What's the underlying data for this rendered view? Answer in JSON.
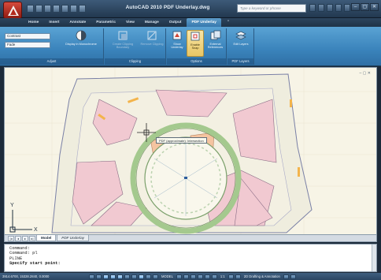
{
  "window": {
    "title": "AutoCAD 2010   PDF Underlay.dwg",
    "search_placeholder": "Type a keyword or phrase",
    "controls": [
      "–",
      "▢",
      "✕"
    ]
  },
  "ribbon": {
    "tabs": [
      {
        "label": "Home",
        "active": false
      },
      {
        "label": "Insert",
        "active": false
      },
      {
        "label": "Annotate",
        "active": false
      },
      {
        "label": "Parametric",
        "active": false
      },
      {
        "label": "View",
        "active": false
      },
      {
        "label": "Manage",
        "active": false
      },
      {
        "label": "Output",
        "active": false
      },
      {
        "label": "PDF Underlay",
        "active": true
      },
      {
        "label": "⌃",
        "active": false
      }
    ],
    "adjust": {
      "title": "Adjust",
      "contrast_label": "Contrast",
      "fade_label": "Fade",
      "monochrome_label": "Display in Monochrome"
    },
    "clipping": {
      "title": "Clipping",
      "create_clip_label": "Create Clipping Boundary",
      "remove_clip_label": "Remove Clipping"
    },
    "options": {
      "title": "Options",
      "show_underlay_label": "Show Underlay",
      "enable_snap_label": "Enable Snap",
      "external_refs_label": "External References"
    },
    "pdf_layers": {
      "title": "PDF Layers",
      "edit_layers_label": "Edit Layers"
    }
  },
  "drawing": {
    "snap_tooltip": "PDF (approximate): Intersection",
    "ucs_x_label": "X",
    "ucs_y_label": "Y",
    "viewport_ctrls": "– ▢ ✕"
  },
  "layout_tabs": {
    "nav": [
      "|◂",
      "◂",
      "▸",
      "▸|"
    ],
    "tabs": [
      {
        "label": "Model",
        "active": true
      },
      {
        "label": "PDF Underlay",
        "active": false
      }
    ]
  },
  "command_line": {
    "lines": [
      "Command:",
      "Command: pl",
      "PLINE"
    ],
    "prompt": "Specify start point:"
  },
  "status_bar": {
    "coords": "3914.6700, 15328.2840, 0.0000",
    "model_label": "MODEL",
    "scale_label": "1:1",
    "workspace_label": "2D Drafting & Annotation"
  },
  "colors": {
    "ribbon_blue": "#3a83bb",
    "drawing_background": "#f7f4e6",
    "room_pink": "#f1c9d1",
    "room_salmon": "#f4c4a0",
    "circle_green": "#a4c98e"
  }
}
